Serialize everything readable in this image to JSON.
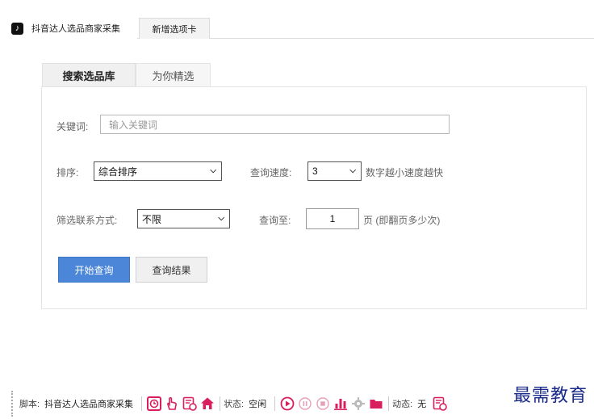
{
  "app_tabs": [
    {
      "label": "抖音达人选品商家采集"
    },
    {
      "label": "新增选项卡"
    }
  ],
  "inner_tabs": [
    {
      "label": "搜索选品库"
    },
    {
      "label": "为你精选"
    }
  ],
  "form": {
    "keyword_label": "关键词:",
    "keyword_placeholder": "输入关键词",
    "sort_label": "排序:",
    "sort_value": "综合排序",
    "speed_label": "查询速度:",
    "speed_value": "3",
    "speed_hint": "数字越小速度越快",
    "contact_label": "筛选联系方式:",
    "contact_value": "不限",
    "query_to_label": "查询至:",
    "query_to_value": "1",
    "query_to_suffix": "页 (即翻页多少次)"
  },
  "buttons": {
    "start": "开始查询",
    "results": "查询结果"
  },
  "statusbar": {
    "script_label": "脚本:",
    "script_value": "抖音达人选品商家采集",
    "state_label": "状态:",
    "state_value": "空闲",
    "dynamic_label": "动态:",
    "dynamic_value": "无",
    "icon_color": "#d81e5b"
  },
  "watermark": "最需教育"
}
